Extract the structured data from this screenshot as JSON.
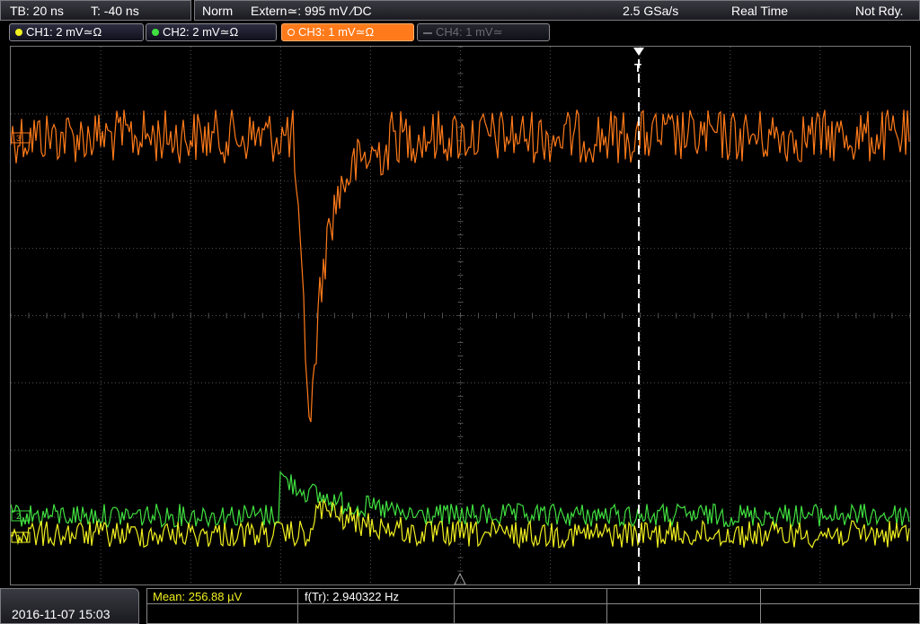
{
  "header": {
    "timebase": "TB: 20 ns",
    "trigger_pos": "T: -40 ns",
    "mode": "Norm",
    "trigger_src": "Extern≃: 995 mV ∕DC",
    "sample_rate": "2.5 GSa/s",
    "acq_mode": "Real Time",
    "status": "Not Rdy."
  },
  "channels": [
    {
      "label": "CH1: 2 mV≃Ω",
      "color": "#f0f020",
      "state": "on"
    },
    {
      "label": "CH2: 2 mV≃Ω",
      "color": "#40e040",
      "state": "on"
    },
    {
      "label": "CH3: 1 mV≃Ω",
      "color": "#ff7a1a",
      "state": "active"
    },
    {
      "label": "CH4: 1 mV≃",
      "color": "#6a6a70",
      "state": "off"
    }
  ],
  "ch_markers": {
    "ch1": "1",
    "ch2": "2",
    "ch3": "3"
  },
  "trigger_marker": "T",
  "footer": {
    "datetime": "2016-11-07 15:03",
    "mean": "Mean: 256.88 µV",
    "freq": "f(Tr): 2.940322 Hz"
  },
  "colors": {
    "ch1": "#f0f020",
    "ch2": "#40e040",
    "ch3": "#ff7a1a",
    "grid": "#555555"
  }
}
